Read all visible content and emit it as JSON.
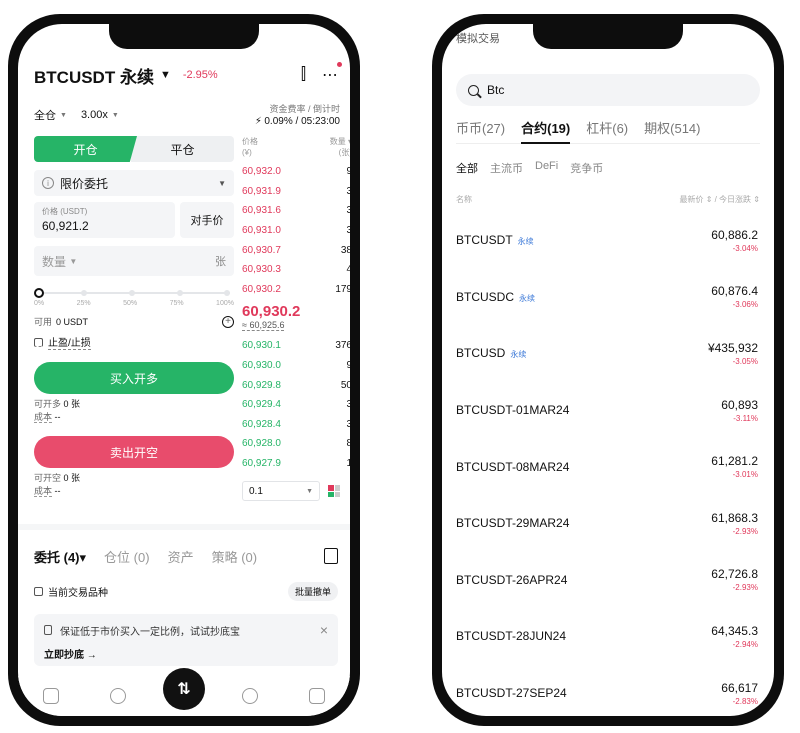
{
  "left": {
    "header": {
      "pair": "BTCUSDT 永续",
      "change": "-2.95%"
    },
    "controls": {
      "margin_mode": "全仓",
      "leverage": "3.00x",
      "funding_label": "资金费率 / 倒计时",
      "funding_value": "0.09% / 05:23:00"
    },
    "form": {
      "open_tab": "开仓",
      "close_tab": "平仓",
      "order_type": "限价委托",
      "price_label": "价格 (USDT)",
      "price_value": "60,921.2",
      "counterparty_label": "对手价",
      "qty_placeholder": "数量",
      "qty_unit": "张",
      "slider_marks": [
        "0%",
        "25%",
        "50%",
        "75%",
        "100%"
      ],
      "available_label": "可用",
      "available_value": "0 USDT",
      "tpsl_label": "止盈/止损",
      "buy_label": "买入开多",
      "can_open_long_label": "可开多",
      "can_open_long_value": "0 张",
      "cost_label": "成本",
      "cost_long_value": "--",
      "sell_label": "卖出开空",
      "can_open_short_label": "可开空",
      "can_open_short_value": "0 张",
      "cost_short_value": "--"
    },
    "book": {
      "price_hdr": "价格",
      "price_unit": "(¥)",
      "qty_hdr": "数量",
      "qty_unit": "(张)",
      "asks": [
        {
          "p": "60,932.0",
          "q": "9"
        },
        {
          "p": "60,931.9",
          "q": "3"
        },
        {
          "p": "60,931.6",
          "q": "3"
        },
        {
          "p": "60,931.0",
          "q": "3"
        },
        {
          "p": "60,930.7",
          "q": "38"
        },
        {
          "p": "60,930.3",
          "q": "4"
        },
        {
          "p": "60,930.2",
          "q": "179"
        }
      ],
      "last_price": "60,930.2",
      "mark_price": "≈ 60,925.6",
      "bids": [
        {
          "p": "60,930.1",
          "q": "376"
        },
        {
          "p": "60,930.0",
          "q": "9"
        },
        {
          "p": "60,929.8",
          "q": "50"
        },
        {
          "p": "60,929.4",
          "q": "3"
        },
        {
          "p": "60,928.4",
          "q": "3"
        },
        {
          "p": "60,928.0",
          "q": "8"
        },
        {
          "p": "60,927.9",
          "q": "1"
        }
      ],
      "depth_step": "0.1"
    },
    "bottom": {
      "tabs": [
        "委托 (4)",
        "仓位 (0)",
        "资产",
        "策略 (0)"
      ],
      "current_only": "当前交易品种",
      "batch": "批量撤单",
      "promo_text": "保证低于市价买入一定比例，试试抄底宝",
      "promo_link": "立即抄底 →"
    },
    "colors": {
      "green": "#26b467",
      "red": "#e0395b"
    }
  },
  "right": {
    "top_peek": "模拟交易",
    "search_value": "Btc",
    "market_tabs": [
      "币币(27)",
      "合约(19)",
      "杠杆(6)",
      "期权(514)"
    ],
    "sub_tabs": [
      "全部",
      "主流币",
      "DeFi",
      "竞争币"
    ],
    "col_name": "名称",
    "col_right": "最新价 ⇕ / 今日涨跌 ⇕",
    "rows": [
      {
        "name": "BTCUSDT",
        "tag": "永续",
        "price": "60,886.2",
        "chg": "-3.04%"
      },
      {
        "name": "BTCUSDC",
        "tag": "永续",
        "price": "60,876.4",
        "chg": "-3.06%"
      },
      {
        "name": "BTCUSD",
        "tag": "永续",
        "price": "¥435,932",
        "chg": "-3.05%"
      },
      {
        "name": "BTCUSDT-01MAR24",
        "tag": "",
        "price": "60,893",
        "chg": "-3.11%"
      },
      {
        "name": "BTCUSDT-08MAR24",
        "tag": "",
        "price": "61,281.2",
        "chg": "-3.01%"
      },
      {
        "name": "BTCUSDT-29MAR24",
        "tag": "",
        "price": "61,868.3",
        "chg": "-2.93%"
      },
      {
        "name": "BTCUSDT-26APR24",
        "tag": "",
        "price": "62,726.8",
        "chg": "-2.93%"
      },
      {
        "name": "BTCUSDT-28JUN24",
        "tag": "",
        "price": "64,345.3",
        "chg": "-2.94%"
      },
      {
        "name": "BTCUSDT-27SEP24",
        "tag": "",
        "price": "66,617",
        "chg": "-2.83%"
      }
    ]
  }
}
